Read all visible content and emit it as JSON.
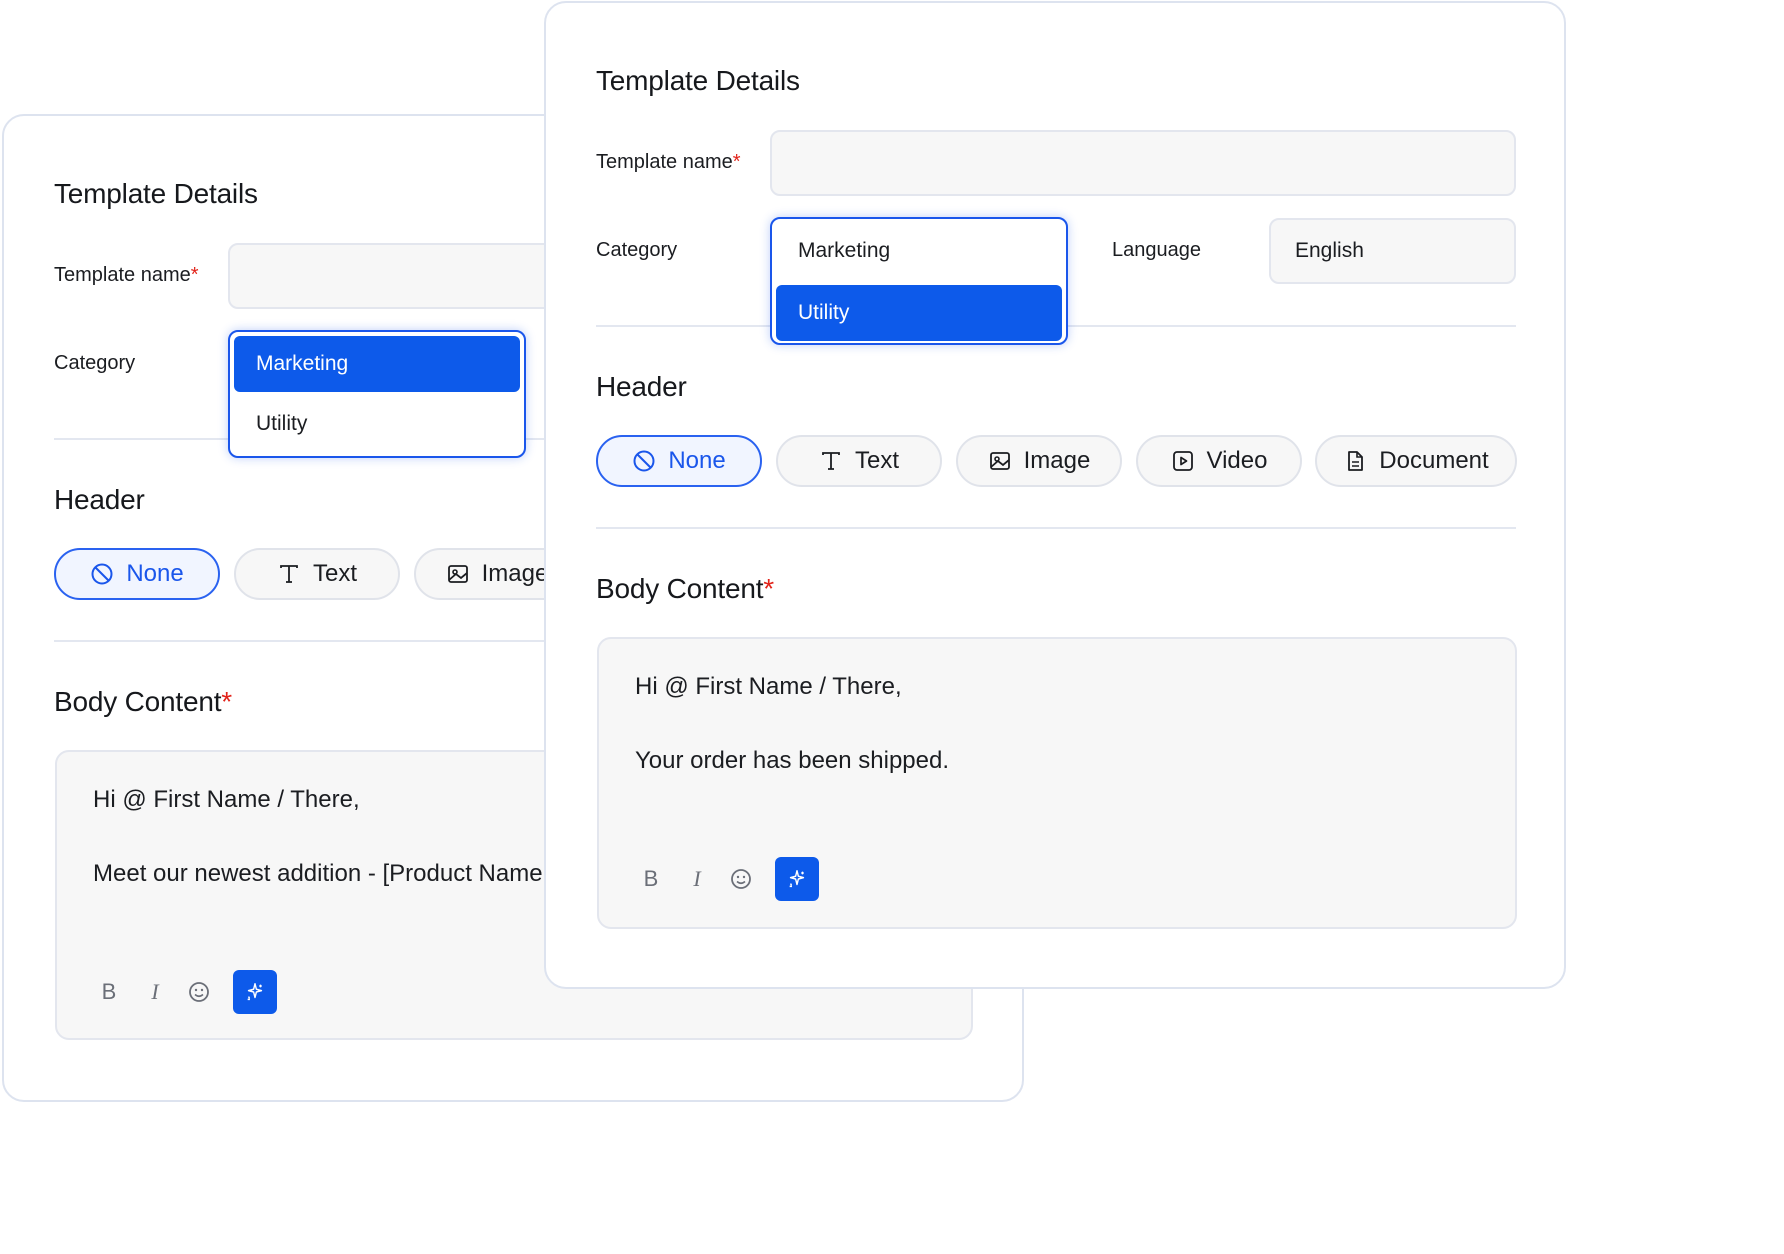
{
  "back": {
    "section_title": "Template Details",
    "template_name_label": "Template name",
    "required_mark": "*",
    "category_label": "Category",
    "dropdown": [
      "Marketing",
      "Utility"
    ],
    "dropdown_selected": "Marketing",
    "header_title": "Header",
    "header_options": [
      "None",
      "Text",
      "Image"
    ],
    "body_title": "Body Content",
    "body_lines": [
      "Hi @ First Name / There,",
      "Meet our newest addition - [Product Name"
    ],
    "toolbar": {
      "bold": "B",
      "italic": "I"
    }
  },
  "front": {
    "section_title": "Template Details",
    "template_name_label": "Template name",
    "required_mark": "*",
    "category_label": "Category",
    "dropdown": [
      "Marketing",
      "Utility"
    ],
    "dropdown_selected": "Utility",
    "language_label": "Language",
    "language_value": "English",
    "header_title": "Header",
    "header_options": [
      "None",
      "Text",
      "Image",
      "Video",
      "Document"
    ],
    "header_selected": "None",
    "body_title": "Body Content",
    "body_lines": [
      "Hi @ First Name / There,",
      "Your order has been shipped."
    ],
    "toolbar": {
      "bold": "B",
      "italic": "I"
    }
  },
  "colors": {
    "accent": "#0d5aea",
    "required": "#e2231a",
    "border": "#e3e6ee",
    "field_bg": "#f7f7f7"
  }
}
